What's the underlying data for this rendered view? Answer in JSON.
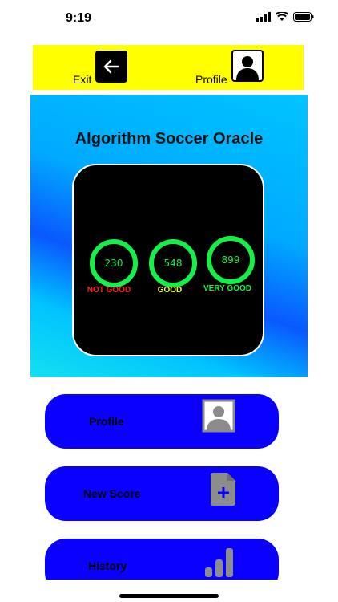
{
  "status_bar": {
    "time": "9:19"
  },
  "top_bar": {
    "exit_label": "Exit",
    "profile_label": "Profile"
  },
  "hero": {
    "title": "Algorithm Soccer Oracle",
    "scores": [
      {
        "value": "230",
        "label": "NOT GOOD",
        "color": "#ff1a1a"
      },
      {
        "value": "548",
        "label": "GOOD",
        "color": "#f5f54a"
      },
      {
        "value": "899",
        "label": "VERY GOOD",
        "color": "#14f048"
      }
    ]
  },
  "menu": [
    {
      "label": "Profile",
      "icon": "profile-icon"
    },
    {
      "label": "New Score",
      "icon": "add-file-icon"
    },
    {
      "label": "History",
      "icon": "bar-chart-icon"
    }
  ],
  "colors": {
    "top_bar": "#ffff00",
    "menu_button": "#0a00ff",
    "gauge_ring": "#14f048"
  }
}
